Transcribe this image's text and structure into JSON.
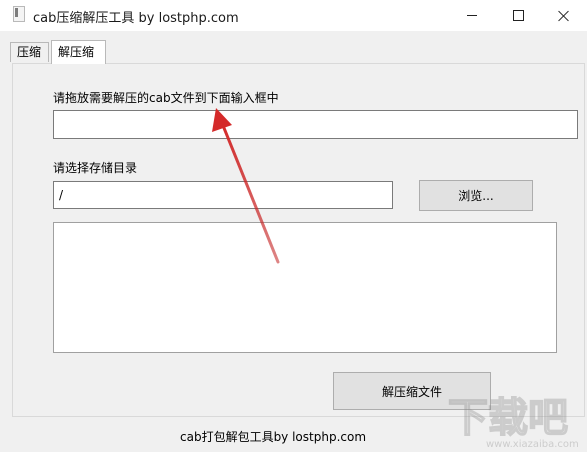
{
  "window": {
    "title": "cab压缩解压工具 by lostphp.com"
  },
  "tabs": [
    {
      "label": "压缩",
      "active": false
    },
    {
      "label": "解压缩",
      "active": true
    }
  ],
  "extract": {
    "source_label": "请拖放需要解压的cab文件到下面输入框中",
    "source_value": "",
    "dest_label": "请选择存储目录",
    "dest_value": "/",
    "browse_label": "浏览...",
    "log_text": "",
    "extract_button": "解压缩文件"
  },
  "footer": {
    "text": "cab打包解包工具by lostphp.com"
  },
  "annotation": {
    "arrow_color": "#d42a2a"
  },
  "icons": {
    "app": "app-icon",
    "minimize": "minimize-icon",
    "maximize": "maximize-icon",
    "close": "close-icon"
  }
}
